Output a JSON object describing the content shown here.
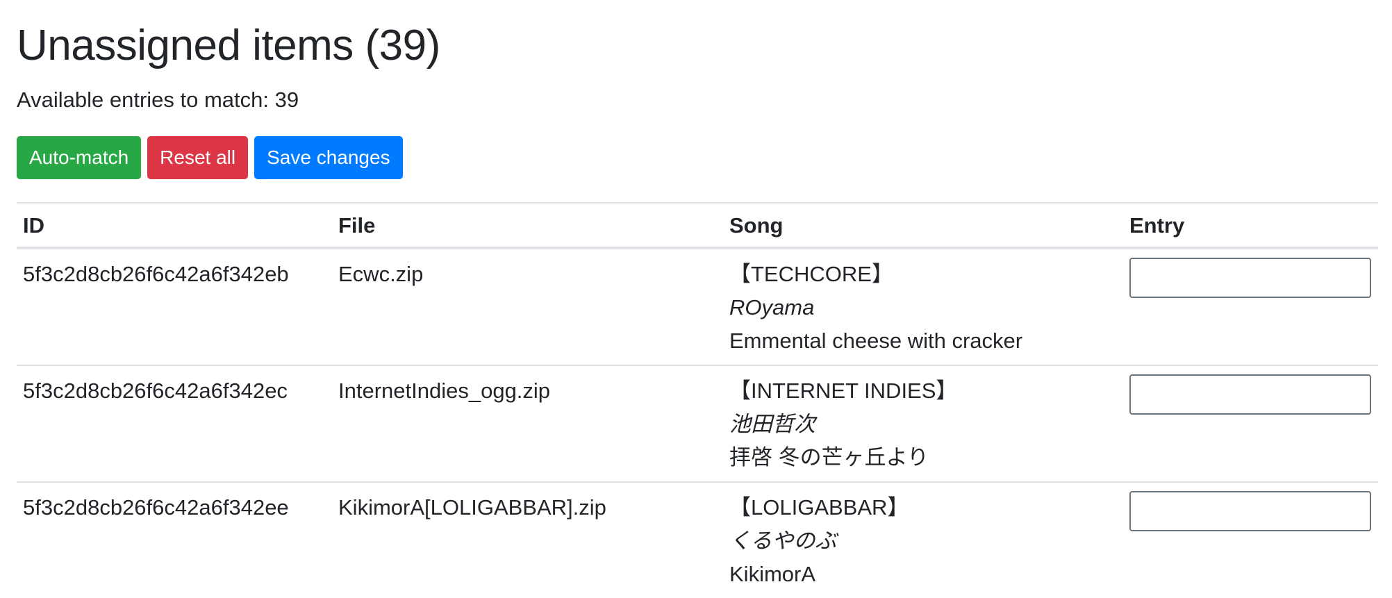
{
  "header": {
    "title": "Unassigned items (39)",
    "summary": "Available entries to match: 39"
  },
  "toolbar": {
    "auto_match_label": "Auto-match",
    "reset_all_label": "Reset all",
    "save_changes_label": "Save changes"
  },
  "table": {
    "columns": {
      "id": "ID",
      "file": "File",
      "song": "Song",
      "entry": "Entry"
    },
    "rows": [
      {
        "id": "5f3c2d8cb26f6c42a6f342eb",
        "file": "Ecwc.zip",
        "genre": "【TECHCORE】",
        "artist": "ROyama",
        "title": "Emmental cheese with cracker",
        "entry_value": ""
      },
      {
        "id": "5f3c2d8cb26f6c42a6f342ec",
        "file": "InternetIndies_ogg.zip",
        "genre": "【INTERNET INDIES】",
        "artist": "池田哲次",
        "title": "拝啓 冬の芒ヶ丘より",
        "entry_value": ""
      },
      {
        "id": "5f3c2d8cb26f6c42a6f342ee",
        "file": "KikimorA[LOLIGABBAR].zip",
        "genre": "【LOLIGABBAR】",
        "artist": "くるやのぶ",
        "title": "KikimorA",
        "entry_value": ""
      }
    ]
  },
  "colors": {
    "success": "#28a745",
    "danger": "#dc3545",
    "primary": "#007bff",
    "text": "#212529",
    "border": "#dee2e6"
  }
}
